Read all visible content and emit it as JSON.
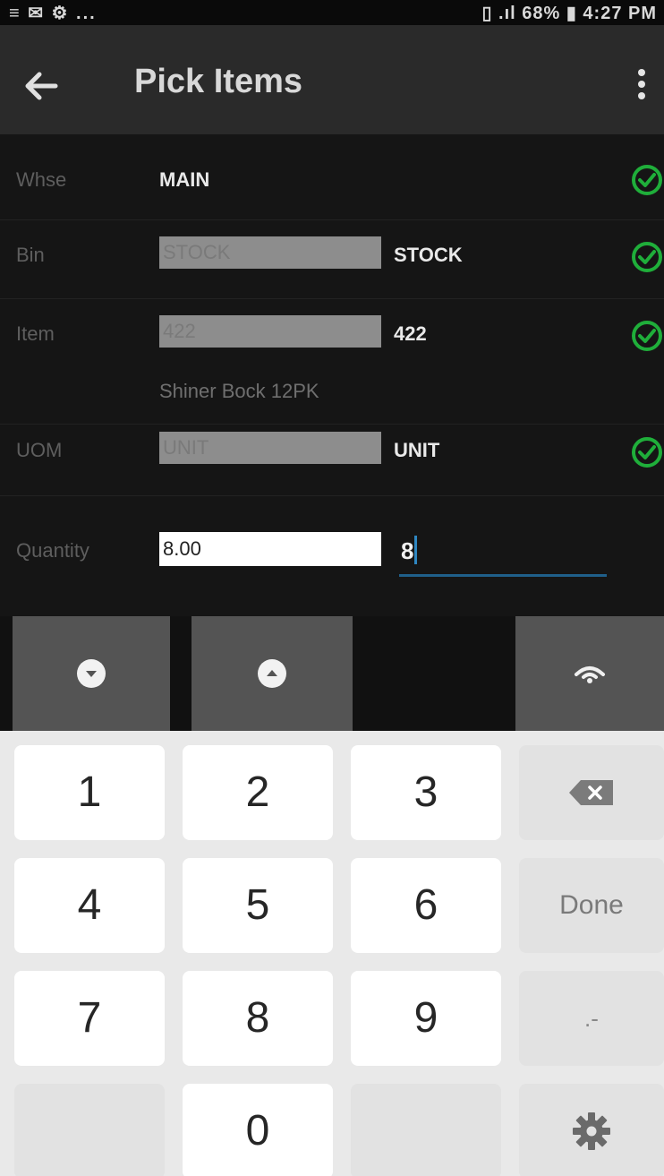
{
  "status_bar": {
    "left_text": "≡ ✉ ⚙ ...",
    "right_text": "▯ .ıl 68% ▮ 4:27 PM"
  },
  "app_bar": {
    "title": "Pick Items"
  },
  "form": {
    "warehouse": {
      "label": "Whse",
      "value": "MAIN"
    },
    "bin": {
      "label": "Bin",
      "input_value": "STOCK",
      "value": "STOCK"
    },
    "item": {
      "label": "Item",
      "input_value": "422",
      "value": "422",
      "description": "Shiner Bock 12PK"
    },
    "uom": {
      "label": "UOM",
      "input_value": "UNIT",
      "value": "UNIT"
    },
    "quantity": {
      "label": "Quantity",
      "default_value": "8.00",
      "entry_value": "8"
    }
  },
  "keyboard": {
    "keys": [
      "1",
      "2",
      "3",
      "4",
      "5",
      "6",
      "7",
      "8",
      "9",
      "0"
    ],
    "done_label": "Done",
    "punct_label": ".-"
  },
  "colors": {
    "check_green": "#1fae3a",
    "accent_blue": "#2e86c1",
    "toolbar_gray": "#545454"
  }
}
